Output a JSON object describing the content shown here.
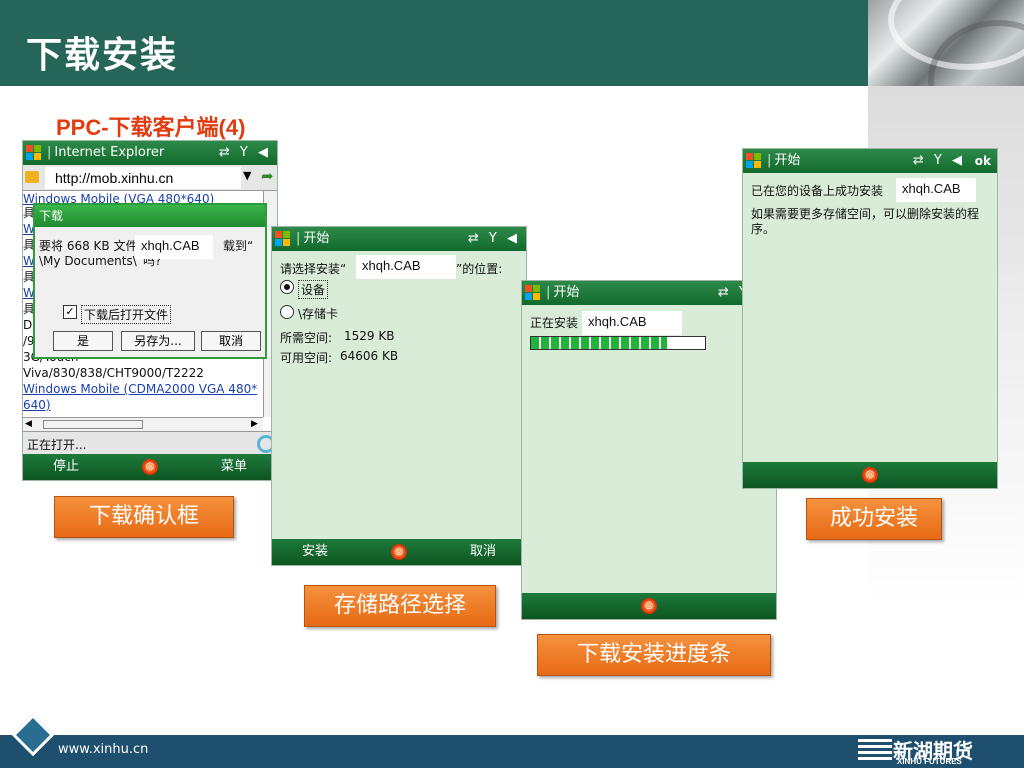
{
  "header": {
    "title": "下载安装"
  },
  "subtitle": "PPC-下载客户端(4)",
  "phone1": {
    "title": "Internet Explorer",
    "url": "http://mob.xinhu.cn",
    "bg_lines": [
      "Windows Mobile (VGA 480*640)",
      "具",
      "W",
      "具",
      "W",
      "具",
      "W",
      "具",
      "Do",
      "/9",
      "3G/Touch",
      "Viva/830/838/CHT9000/T2222",
      "Windows Mobile (CDMA2000 VGA 480*",
      "640)"
    ],
    "dialog": {
      "title": "下载",
      "message_line1": "要将 668 KB 文件",
      "message_line1_end": "载到“",
      "message_line2": "\\My Documents\\”吗?",
      "checkbox_label": "下载后打开文件",
      "buttons": [
        "是",
        "另存为...",
        "取消"
      ]
    },
    "cab": "xhqh.CAB",
    "status": "正在打开...",
    "soft_left": "停止",
    "soft_right": "菜单"
  },
  "phone2": {
    "title": "开始",
    "prompt": "请选择安装“",
    "prompt_end": "”的位置:",
    "cab": "xhqh.CAB",
    "options": [
      "设备",
      "\\存储卡"
    ],
    "required_label": "所需空间:",
    "required_value": "1529 KB",
    "available_label": "可用空间:",
    "available_value": "64606 KB",
    "soft_left": "安装",
    "soft_right": "取消"
  },
  "phone3": {
    "title": "开始",
    "status": "正在安装",
    "cab": "xhqh.CAB",
    "progress": 0.78
  },
  "phone4": {
    "title": "开始",
    "ok": "ok",
    "line1": "已在您的设备上成功安装",
    "cab": "xhqh.CAB",
    "line2": "如果需要更多存储空间，可以删除安装的程序。"
  },
  "captions": {
    "c1": "下载确认框",
    "c2": "存储路径选择",
    "c3": "下载安装进度条",
    "c4": "成功安装"
  },
  "footer": {
    "url": "www.xinhu.cn",
    "logo_cn": "新湖期货",
    "logo_en": "XINHU FUTURES"
  },
  "colors": {
    "header": "#266659",
    "phone_bg": "#d9ecd7",
    "caption": "#e86a14",
    "footer": "#1f4f6e",
    "subtitle": "#e03c10"
  }
}
